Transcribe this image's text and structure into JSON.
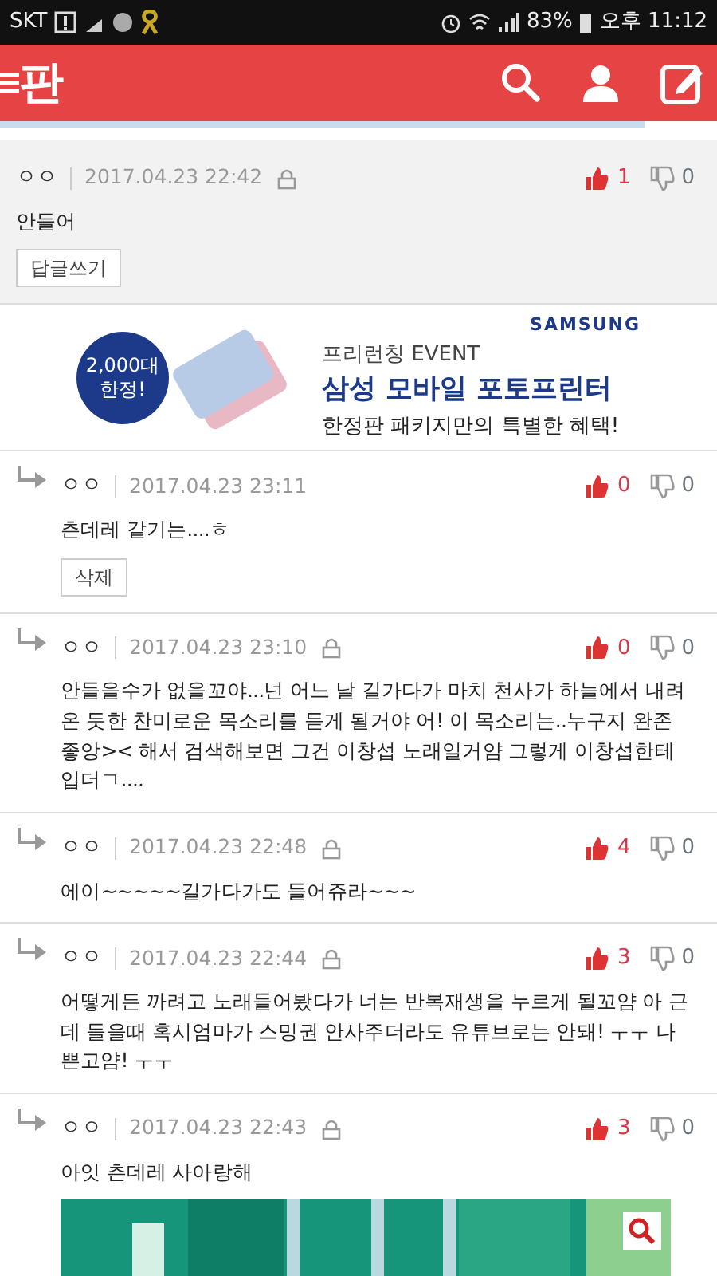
{
  "status_bar": {
    "carrier": "SKT",
    "battery": "83%",
    "time": "오후 11:12"
  },
  "header": {
    "logo": "판"
  },
  "comments": [
    {
      "reply": false,
      "author": "ㅇㅇ",
      "date": "2017.04.23 22:42",
      "locked": true,
      "likes": "1",
      "dislikes": "0",
      "text": "안들어",
      "button": "답글쓰기"
    },
    {
      "kind": "ad",
      "brand": "SAMSUNG",
      "badge_line_1": "2,000대",
      "badge_line_2": "한정!",
      "eyebrow": "프리런칭 EVENT",
      "headline": "삼성 모바일 포토프린터",
      "subline": "한정판 패키지만의 특별한 혜택!"
    },
    {
      "reply": true,
      "author": "ㅇㅇ",
      "date": "2017.04.23 23:11",
      "locked": false,
      "likes": "0",
      "dislikes": "0",
      "text": "츤데레 같기는....ㅎ",
      "button": "삭제"
    },
    {
      "reply": true,
      "author": "ㅇㅇ",
      "date": "2017.04.23 23:10",
      "locked": true,
      "likes": "0",
      "dislikes": "0",
      "text": "안들을수가 없을꼬야...넌 어느 날 길가다가 마치 천사가 하늘에서 내려온 듯한 찬미로운 목소리를 듣게 될거야 어! 이 목소리는..누구지 완존 좋앙>< 해서 검색해보면 그건 이창섭 노래일거얌 그렇게 이창섭한테 입더ㄱ...."
    },
    {
      "reply": true,
      "author": "ㅇㅇ",
      "date": "2017.04.23 22:48",
      "locked": true,
      "likes": "4",
      "dislikes": "0",
      "text": "에이~~~~~길가다가도 들어쥬라~~~"
    },
    {
      "reply": true,
      "author": "ㅇㅇ",
      "date": "2017.04.23 22:44",
      "locked": true,
      "likes": "3",
      "dislikes": "0",
      "text": "어떻게든 까려고 노래들어봤다가 너는 반복재생을 누르게 될꼬얌 아 근데 들을때 혹시엄마가 스밍권 안사주더라도 유튜브로는 안돼! ㅜㅜ 나쁜고얌! ㅜㅜ"
    },
    {
      "reply": true,
      "author": "ㅇㅇ",
      "date": "2017.04.23 22:43",
      "locked": true,
      "likes": "3",
      "dislikes": "0",
      "text": "아잇 츤데레 사아랑해"
    }
  ]
}
